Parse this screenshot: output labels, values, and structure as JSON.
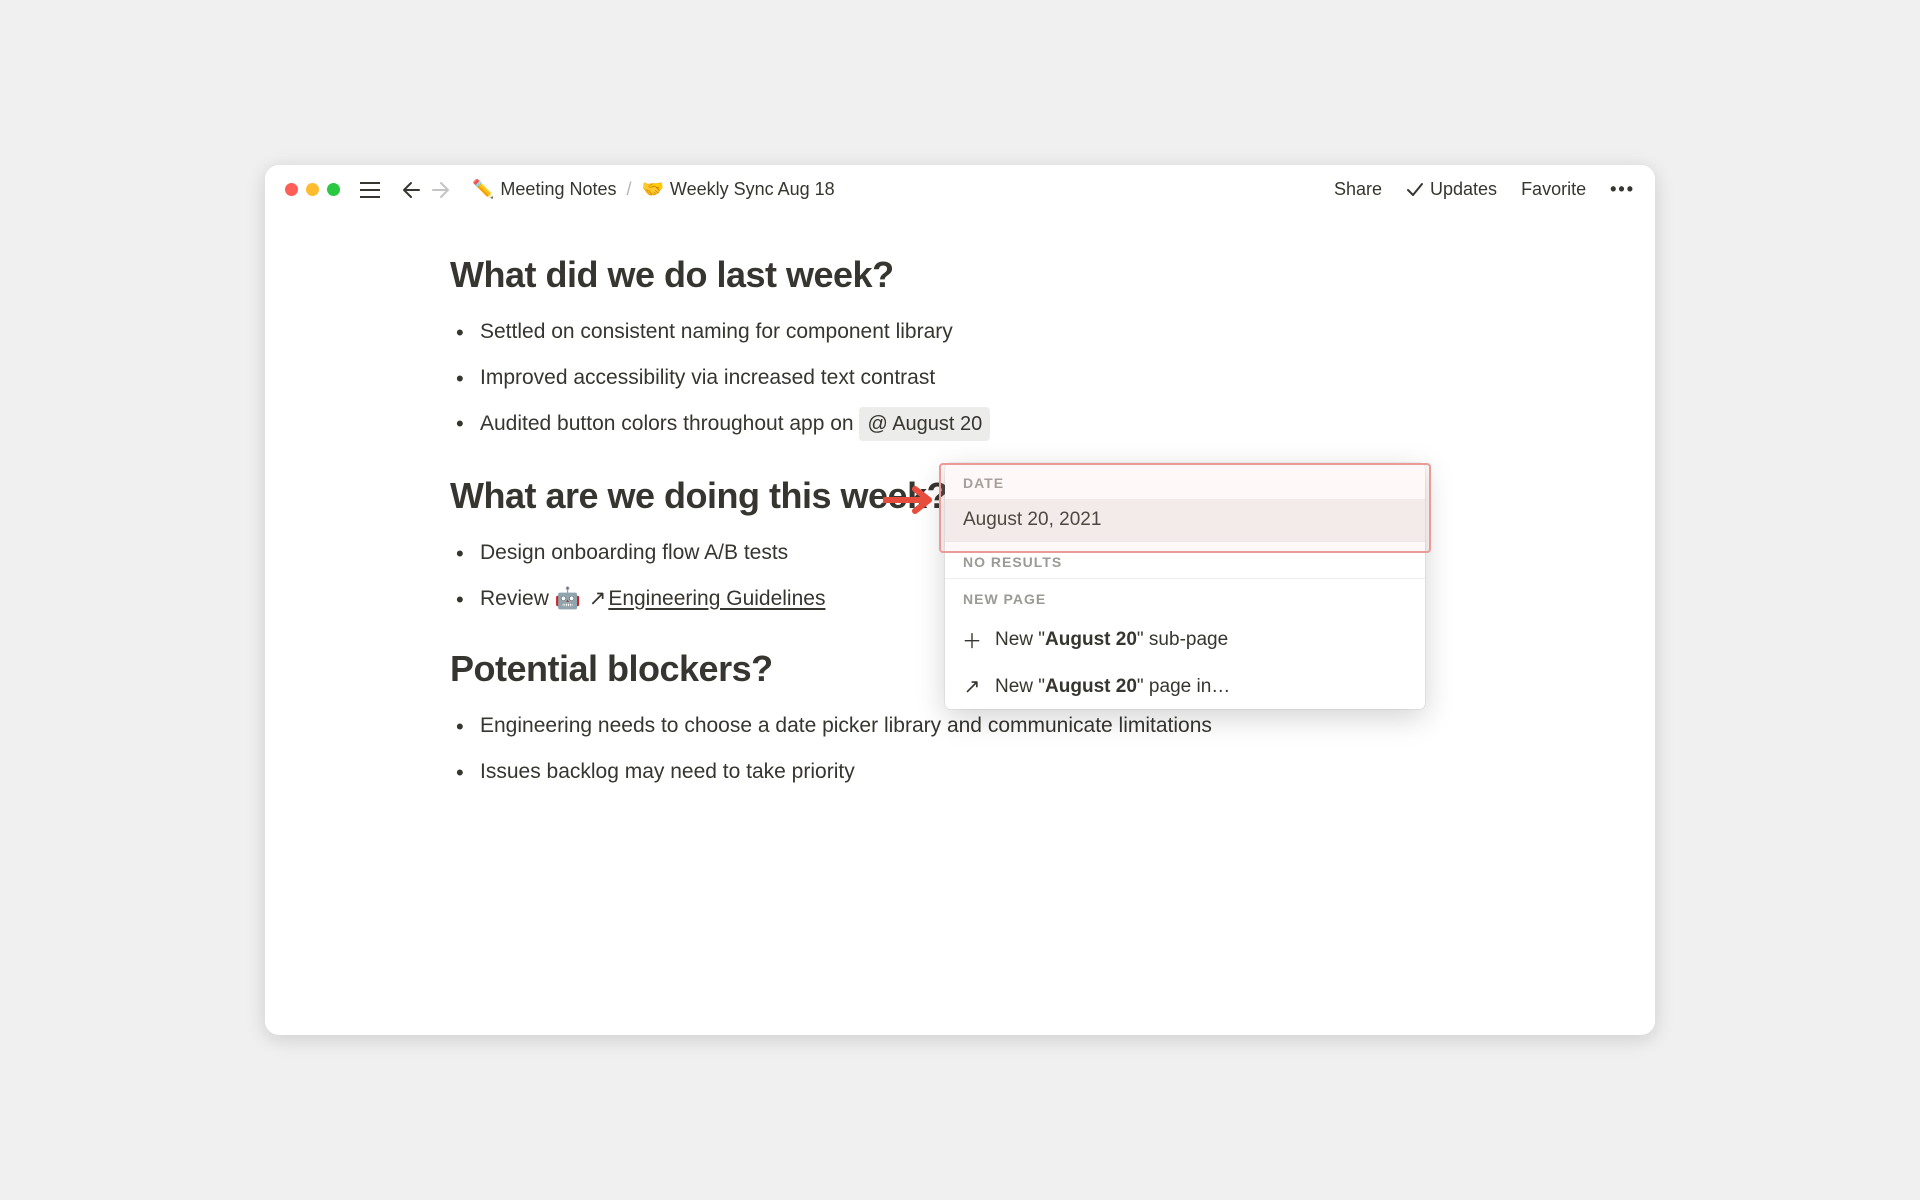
{
  "breadcrumb": {
    "parent_icon": "✏️",
    "parent_label": "Meeting Notes",
    "current_icon": "🤝",
    "current_label": "Weekly Sync Aug 18"
  },
  "topbar": {
    "share": "Share",
    "updates": "Updates",
    "favorite": "Favorite"
  },
  "sections": {
    "last_week": {
      "heading": "What did we do last week?",
      "items": [
        "Settled on consistent naming for component library",
        "Improved accessibility via increased text contrast"
      ],
      "item3_prefix": "Audited button colors throughout app on ",
      "item3_mention": "@ August 20"
    },
    "this_week": {
      "heading": "What are we doing this week?",
      "items": [
        "Design onboarding flow A/B tests"
      ],
      "item2_prefix": "Review ",
      "item2_emoji": "🤖",
      "item2_link": "Engineering Guidelines"
    },
    "blockers": {
      "heading": "Potential blockers?",
      "items": [
        "Engineering needs to choose a date picker library and communicate limitations",
        "Issues backlog may need to take priority"
      ]
    }
  },
  "popup": {
    "date_label": "DATE",
    "date_value": "August 20, 2021",
    "no_results": "NO RESULTS",
    "new_page_label": "NEW PAGE",
    "new_subpage_prefix": "New \"",
    "new_subpage_term": "August 20",
    "new_subpage_suffix": "\" sub-page",
    "new_pagein_prefix": "New \"",
    "new_pagein_term": "August 20",
    "new_pagein_suffix": "\" page in…"
  }
}
